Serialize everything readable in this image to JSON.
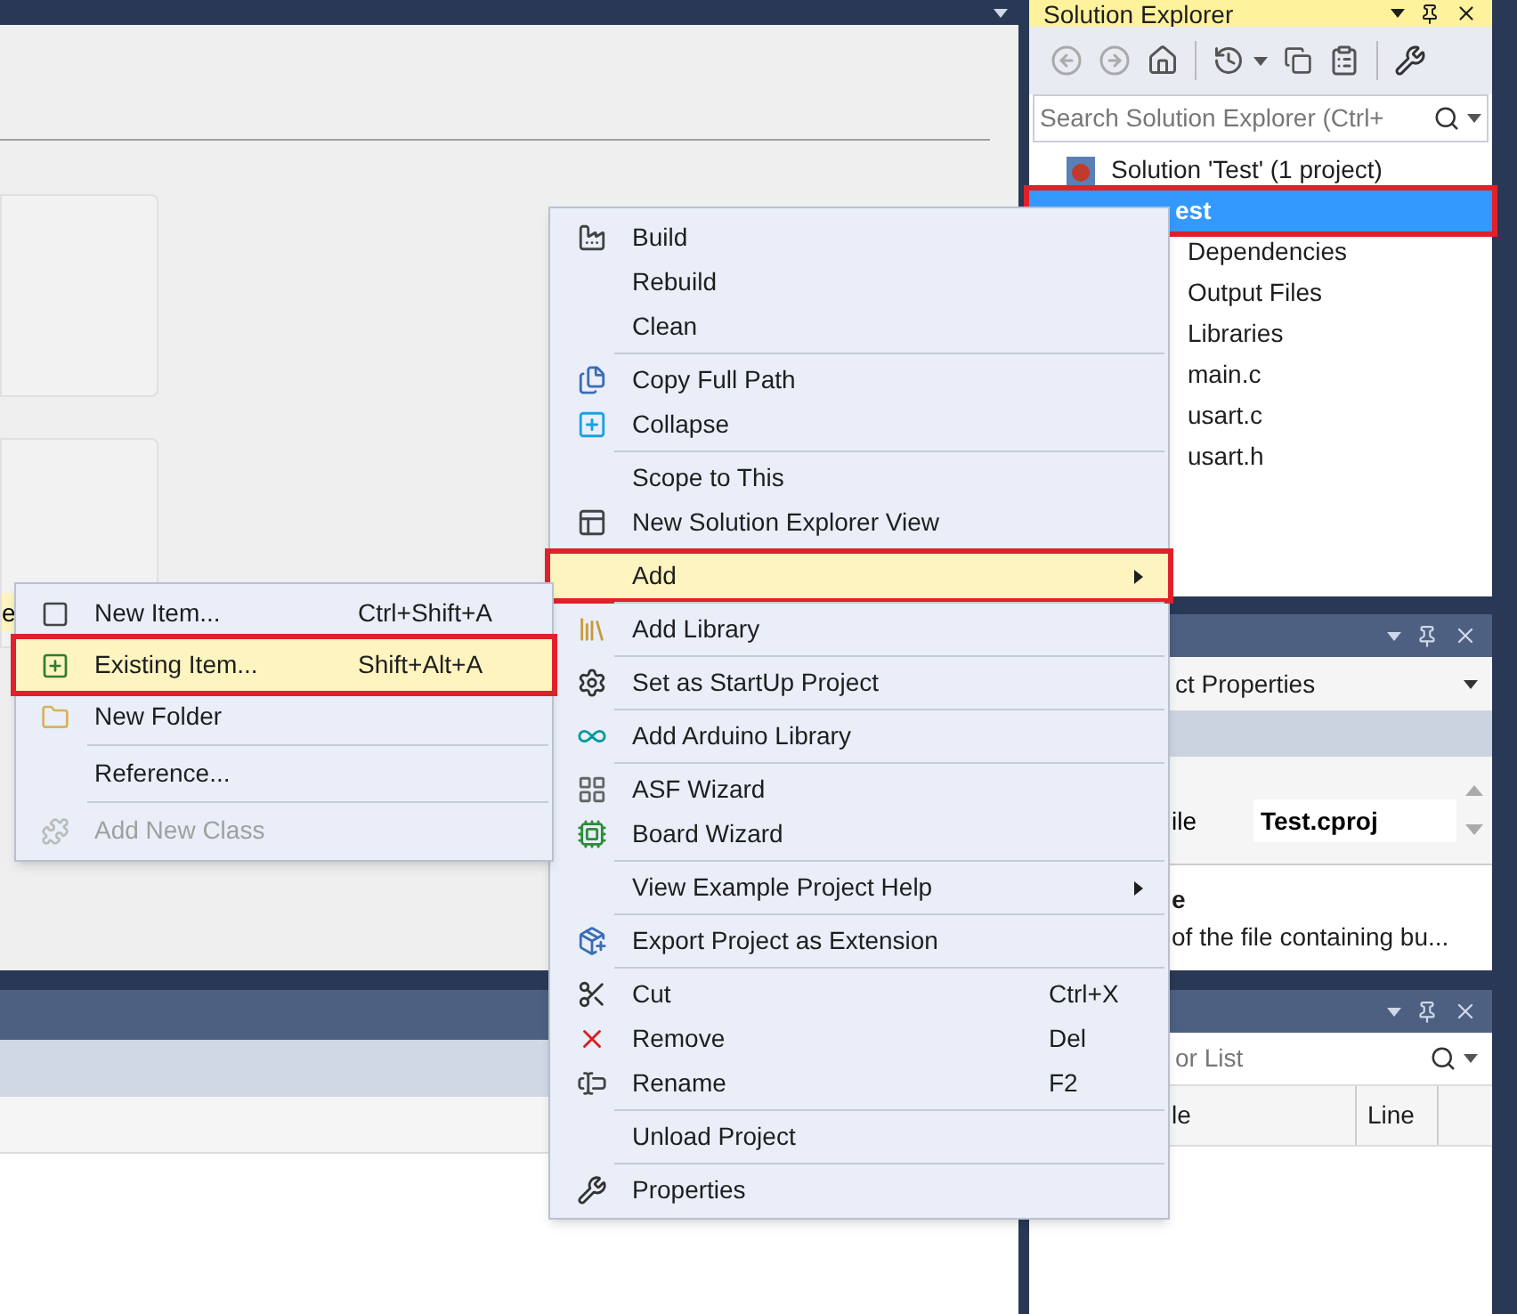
{
  "document": {
    "fragment": "e"
  },
  "solution_explorer": {
    "title": "Solution Explorer",
    "search": {
      "placeholder": "Search Solution Explorer (Ctrl+"
    },
    "tree": [
      {
        "label": "Solution 'Test' (1 project)",
        "selected": false,
        "outlined": false,
        "children": [
          {
            "label": "est",
            "selected": true,
            "outlined": true,
            "children": [
              {
                "label": "Dependencies",
                "selected": false,
                "outlined": false
              },
              {
                "label": "Output Files",
                "selected": false,
                "outlined": false
              },
              {
                "label": "Libraries",
                "selected": false,
                "outlined": false
              },
              {
                "label": "main.c",
                "selected": false,
                "outlined": false
              },
              {
                "label": "usart.c",
                "selected": false,
                "outlined": false
              },
              {
                "label": "usart.h",
                "selected": false,
                "outlined": false
              }
            ]
          }
        ]
      }
    ]
  },
  "properties": {
    "object_selector": "ct Properties",
    "rows": [
      {
        "name": "ile",
        "value": "Test.cproj"
      }
    ],
    "description_title": "e",
    "description": "of the file containing bu..."
  },
  "error_list": {
    "search": {
      "placeholder": "or List"
    },
    "columns": [
      "le",
      "Line"
    ]
  },
  "context_menu": {
    "items": [
      {
        "kind": "item",
        "label": "Build",
        "selected": false,
        "outlined": false,
        "has_submenu": false
      },
      {
        "kind": "item",
        "label": "Rebuild",
        "selected": false,
        "outlined": false,
        "has_submenu": false
      },
      {
        "kind": "item",
        "label": "Clean",
        "selected": false,
        "outlined": false,
        "has_submenu": false
      },
      {
        "kind": "separator"
      },
      {
        "kind": "item",
        "label": "Copy Full Path",
        "selected": false,
        "outlined": false,
        "has_submenu": false
      },
      {
        "kind": "item",
        "label": "Collapse",
        "selected": false,
        "outlined": false,
        "has_submenu": false
      },
      {
        "kind": "separator"
      },
      {
        "kind": "item",
        "label": "Scope to This",
        "selected": false,
        "outlined": false,
        "has_submenu": false
      },
      {
        "kind": "item",
        "label": "New Solution Explorer View",
        "selected": false,
        "outlined": false,
        "has_submenu": false
      },
      {
        "kind": "separator"
      },
      {
        "kind": "item",
        "label": "Add",
        "selected": true,
        "outlined": true,
        "has_submenu": true
      },
      {
        "kind": "separator"
      },
      {
        "kind": "item",
        "label": "Add Library",
        "selected": false,
        "outlined": false,
        "has_submenu": false
      },
      {
        "kind": "separator"
      },
      {
        "kind": "item",
        "label": "Set as StartUp Project",
        "selected": false,
        "outlined": false,
        "has_submenu": false
      },
      {
        "kind": "separator"
      },
      {
        "kind": "item",
        "label": "Add Arduino Library",
        "selected": false,
        "outlined": false,
        "has_submenu": false
      },
      {
        "kind": "separator"
      },
      {
        "kind": "item",
        "label": "ASF Wizard",
        "selected": false,
        "outlined": false,
        "has_submenu": false
      },
      {
        "kind": "item",
        "label": "Board Wizard",
        "selected": false,
        "outlined": false,
        "has_submenu": false
      },
      {
        "kind": "separator"
      },
      {
        "kind": "item",
        "label": "View Example Project Help",
        "selected": false,
        "outlined": false,
        "has_submenu": true
      },
      {
        "kind": "separator"
      },
      {
        "kind": "item",
        "label": "Export Project as Extension",
        "selected": false,
        "outlined": false,
        "has_submenu": false
      },
      {
        "kind": "separator"
      },
      {
        "kind": "item",
        "label": "Cut",
        "shortcut": "Ctrl+X",
        "selected": false,
        "outlined": false,
        "has_submenu": false
      },
      {
        "kind": "item",
        "label": "Remove",
        "shortcut": "Del",
        "selected": false,
        "outlined": false,
        "has_submenu": false
      },
      {
        "kind": "item",
        "label": "Rename",
        "shortcut": "F2",
        "selected": false,
        "outlined": false,
        "has_submenu": false
      },
      {
        "kind": "separator"
      },
      {
        "kind": "item",
        "label": "Unload Project",
        "selected": false,
        "outlined": false,
        "has_submenu": false
      },
      {
        "kind": "separator"
      },
      {
        "kind": "item",
        "label": "Properties",
        "selected": false,
        "outlined": false,
        "has_submenu": false
      }
    ]
  },
  "add_submenu": {
    "items": [
      {
        "kind": "item",
        "label": "New Item...",
        "shortcut": "Ctrl+Shift+A",
        "selected": false,
        "outlined": false,
        "disabled": false
      },
      {
        "kind": "item",
        "label": "Existing Item...",
        "shortcut": "Shift+Alt+A",
        "selected": true,
        "outlined": true,
        "disabled": false
      },
      {
        "kind": "item",
        "label": "New Folder",
        "selected": false,
        "outlined": false,
        "disabled": false
      },
      {
        "kind": "separator"
      },
      {
        "kind": "item",
        "label": "Reference...",
        "selected": false,
        "outlined": false,
        "disabled": false
      },
      {
        "kind": "separator"
      },
      {
        "kind": "item",
        "label": "Add New Class",
        "selected": false,
        "outlined": false,
        "disabled": true
      }
    ]
  }
}
